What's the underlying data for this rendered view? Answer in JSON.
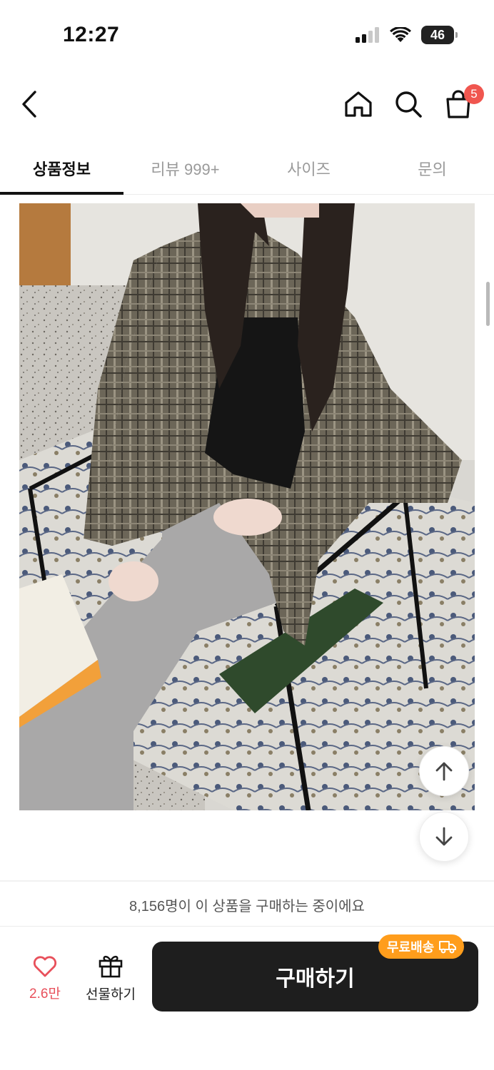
{
  "status_bar": {
    "time": "12:27",
    "battery": "46"
  },
  "header": {
    "cart_count": "5"
  },
  "tabs": [
    {
      "label": "상품정보",
      "active": true
    },
    {
      "label": "리뷰 999+",
      "active": false
    },
    {
      "label": "사이즈",
      "active": false
    },
    {
      "label": "문의",
      "active": false
    }
  ],
  "viewers_text": "8,156명이 이 상품을 구매하는 중이에요",
  "bottom_bar": {
    "like_count": "2.6만",
    "gift_label": "선물하기",
    "buy_label": "구매하기",
    "shipping_badge": "무료배송"
  },
  "colors": {
    "accent": "#f0564f",
    "buy_button": "#1e1e1e",
    "shipping_badge": "#ff9d1c"
  }
}
